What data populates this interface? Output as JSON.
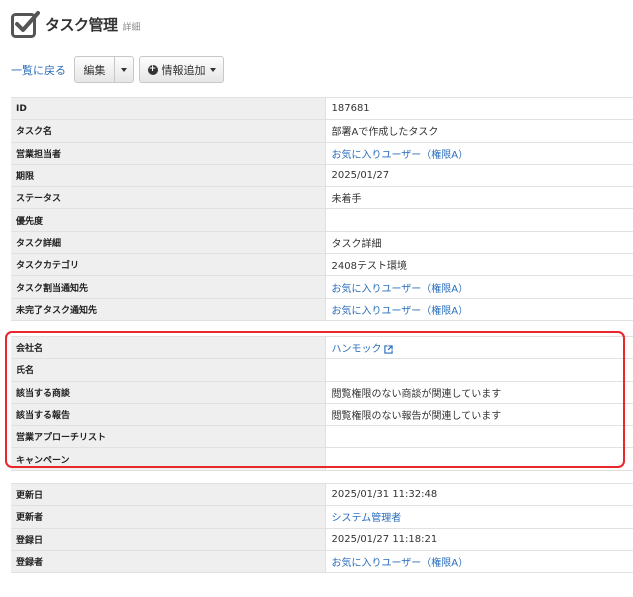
{
  "header": {
    "title": "タスク管理",
    "subtitle": "詳細",
    "icon": "checkbox-icon"
  },
  "toolbar": {
    "back_label": "一覧に戻る",
    "edit_label": "編集",
    "add_info_label": "情報追加"
  },
  "section1": {
    "rows": [
      {
        "label": "ID",
        "value": "187681",
        "link": false
      },
      {
        "label": "タスク名",
        "value": "部署Aで作成したタスク",
        "link": false
      },
      {
        "label": "営業担当者",
        "value": "お気に入りユーザー（権限A）",
        "link": true
      },
      {
        "label": "期限",
        "value": "2025/01/27",
        "link": false
      },
      {
        "label": "ステータス",
        "value": "未着手",
        "link": false
      },
      {
        "label": "優先度",
        "value": "",
        "link": false
      },
      {
        "label": "タスク詳細",
        "value": "タスク詳細",
        "link": false
      },
      {
        "label": "タスクカテゴリ",
        "value": "2408テスト環境",
        "link": false
      },
      {
        "label": "タスク割当通知先",
        "value": "お気に入りユーザー（権限A）",
        "link": true
      },
      {
        "label": "未完了タスク通知先",
        "value": "お気に入りユーザー（権限A）",
        "link": true
      }
    ]
  },
  "section2": {
    "rows": [
      {
        "label": "会社名",
        "value": "ハンモック",
        "link": true,
        "external": true
      },
      {
        "label": "氏名",
        "value": "",
        "link": false
      },
      {
        "label": "該当する商談",
        "value": "閲覧権限のない商談が関連しています",
        "link": false
      },
      {
        "label": "該当する報告",
        "value": "閲覧権限のない報告が関連しています",
        "link": false
      },
      {
        "label": "営業アプローチリスト",
        "value": "",
        "link": false
      },
      {
        "label": "キャンペーン",
        "value": "",
        "link": false
      }
    ]
  },
  "section3": {
    "rows": [
      {
        "label": "更新日",
        "value": "2025/01/31 11:32:48",
        "link": false
      },
      {
        "label": "更新者",
        "value": "システム管理者",
        "link": true
      },
      {
        "label": "登録日",
        "value": "2025/01/27 11:18:21",
        "link": false
      },
      {
        "label": "登録者",
        "value": "お気に入りユーザー（権限A）",
        "link": true
      }
    ]
  },
  "colors": {
    "link": "#2a6ebb",
    "highlight": "#e8262b",
    "label_bg": "#efefef"
  }
}
